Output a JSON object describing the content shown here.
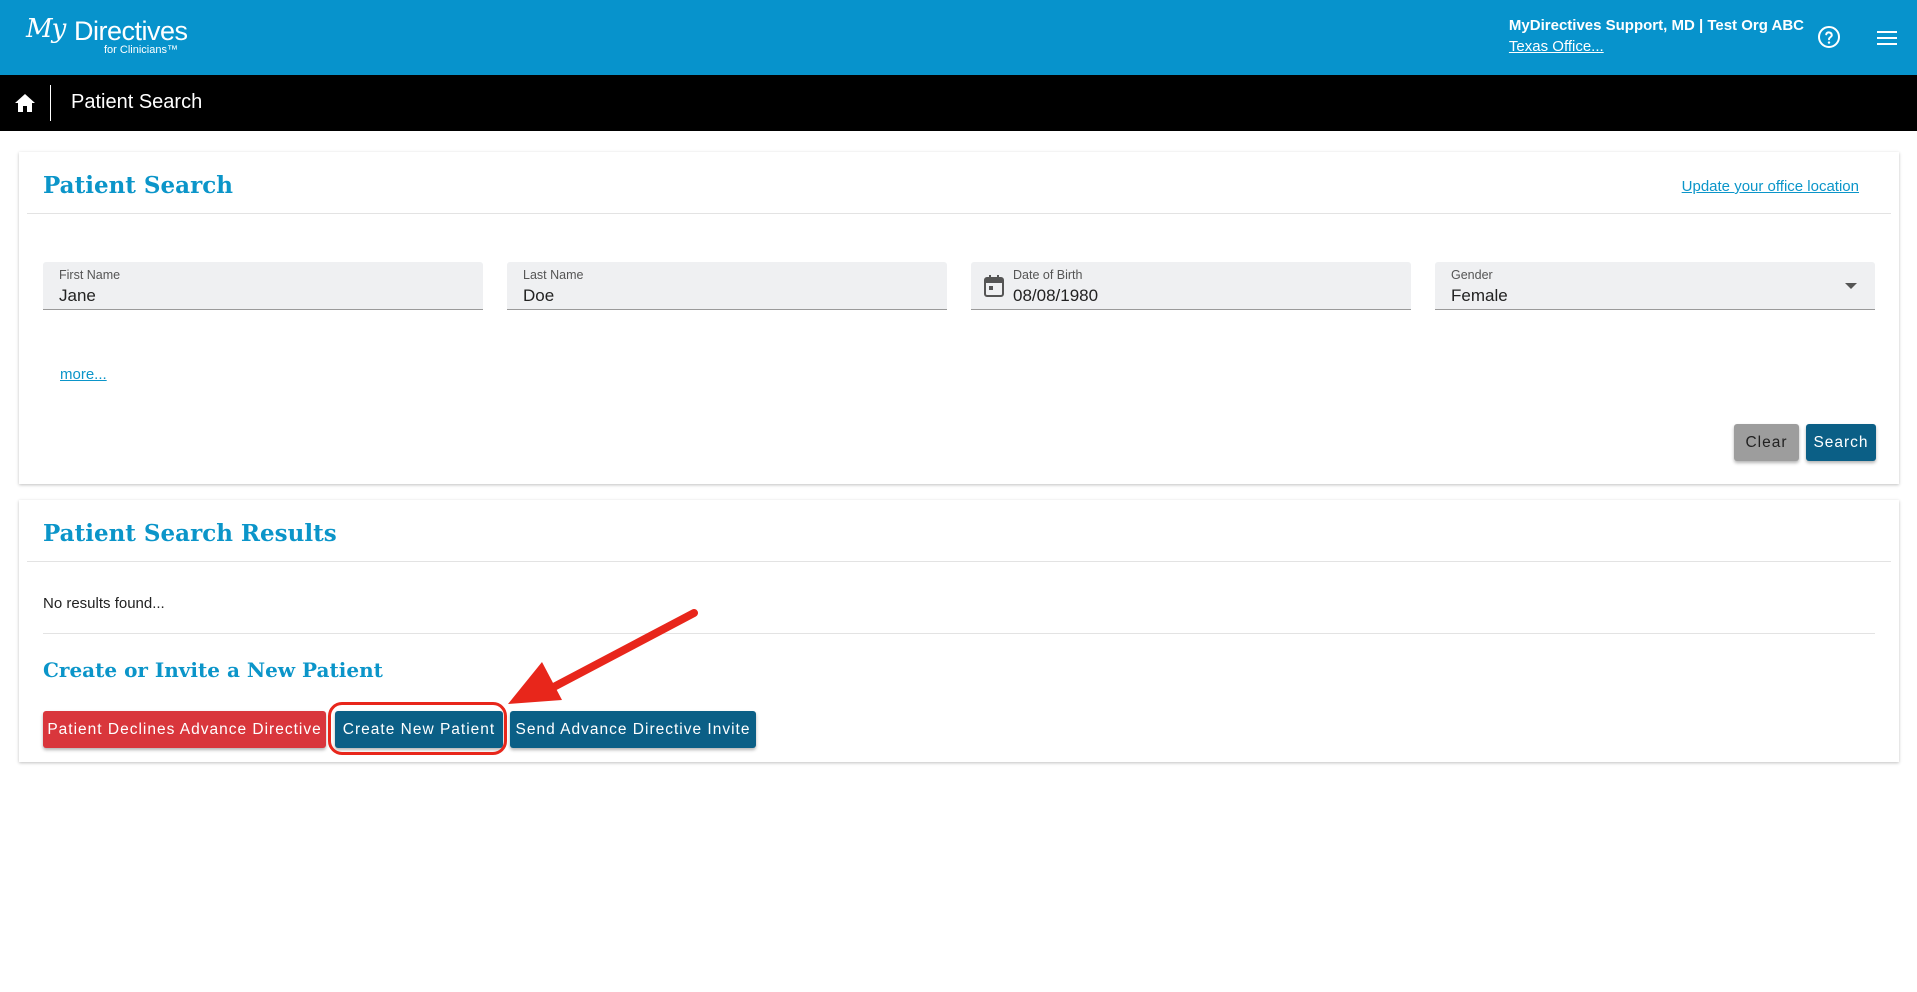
{
  "header": {
    "logo_script": "My",
    "logo_word": "Directives",
    "logo_sub": "for Clinicians™",
    "user_name": "MyDirectives Support, MD | Test Org ABC",
    "office_link": "Texas Office...",
    "help_icon": "help-circle-icon",
    "menu_icon": "hamburger-menu-icon"
  },
  "breadcrumb": {
    "home_icon": "home-icon",
    "title": "Patient Search"
  },
  "search_card": {
    "title": "Patient Search",
    "office_link": "Update your office location",
    "fields": {
      "first_name": {
        "label": "First Name",
        "value": "Jane"
      },
      "last_name": {
        "label": "Last Name",
        "value": "Doe"
      },
      "dob": {
        "label": "Date of Birth",
        "value": "08/08/1980"
      },
      "gender": {
        "label": "Gender",
        "value": "Female"
      }
    },
    "more_link": "more...",
    "clear_label": "Clear",
    "search_label": "Search"
  },
  "results_card": {
    "title": "Patient Search Results",
    "no_results": "No results found...",
    "create_title": "Create or Invite a New Patient",
    "decline_label": "Patient Declines Advance Directive",
    "create_label": "Create New Patient",
    "invite_label": "Send Advance Directive Invite"
  },
  "colors": {
    "header_bg": "#0793cc",
    "navbar_bg": "#000000",
    "accent_text": "#0b95c9",
    "primary_button": "#0b5f86",
    "danger_button": "#d9363c",
    "annotation": "#e8261b"
  }
}
